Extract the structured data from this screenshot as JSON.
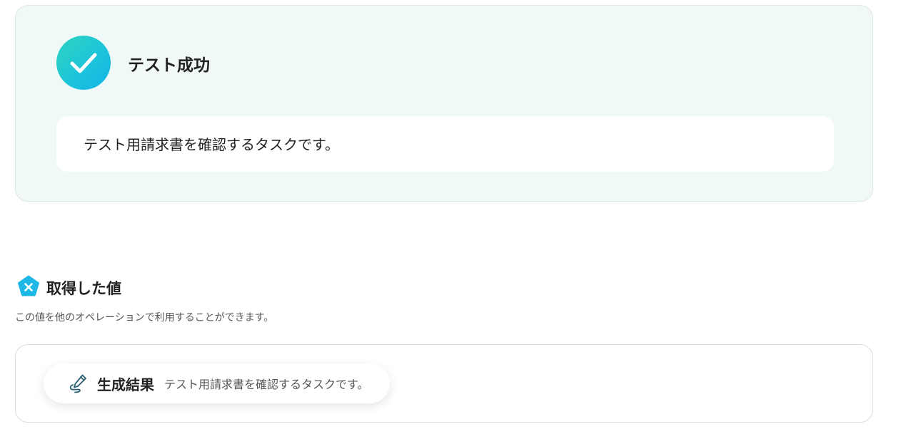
{
  "test_result": {
    "title": "テスト成功",
    "message": "テスト用請求書を確認するタスクです。",
    "status_color": "#1ec6d8"
  },
  "acquired_values": {
    "heading": "取得した値",
    "description": "この値を他のオペレーションで利用することができます。",
    "icon": "close-badge-icon",
    "icon_color": "#1fb8e6",
    "items": [
      {
        "icon": "pen-icon",
        "label": "生成結果",
        "value": "テスト用請求書を確認するタスクです。"
      }
    ]
  }
}
